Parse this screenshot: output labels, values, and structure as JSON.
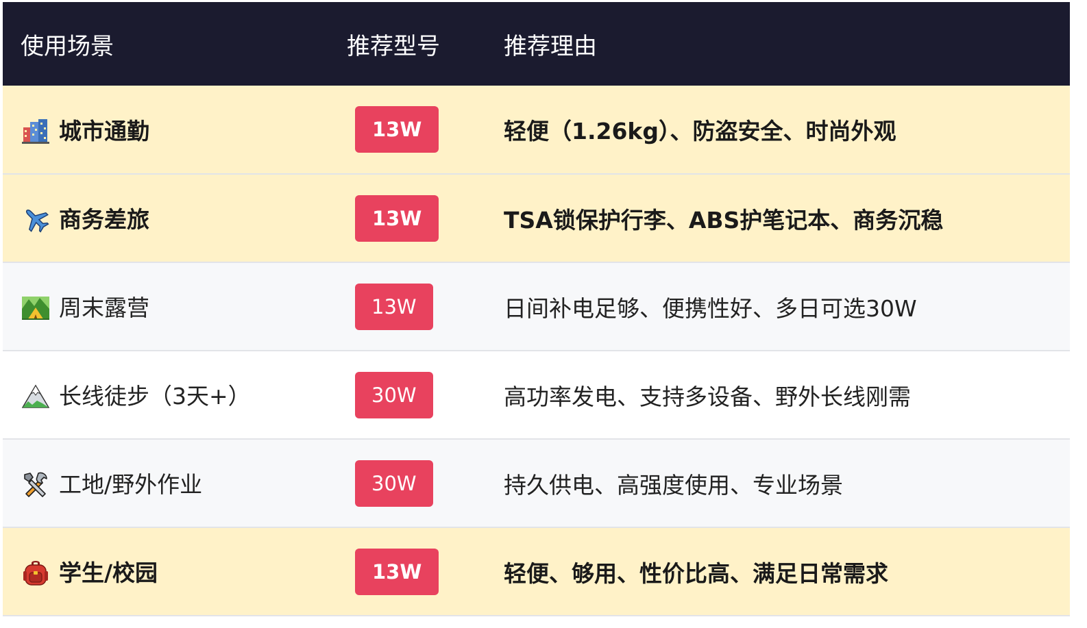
{
  "table": {
    "headers": [
      "使用场景",
      "推荐型号",
      "推荐理由"
    ],
    "rows": [
      {
        "icon": "cityscape-icon",
        "scene": "城市通勤",
        "model": "13W",
        "reason": "轻便（1.26kg）、防盗安全、时尚外观",
        "highlight": true
      },
      {
        "icon": "airplane-icon",
        "scene": "商务差旅",
        "model": "13W",
        "reason": "TSA锁保护行李、ABS护笔记本、商务沉稳",
        "highlight": true
      },
      {
        "icon": "camping-icon",
        "scene": "周末露营",
        "model": "13W",
        "reason": "日间补电足够、便携性好、多日可选30W",
        "highlight": false
      },
      {
        "icon": "mountain-icon",
        "scene": "长线徒步（3天+）",
        "model": "30W",
        "reason": "高功率发电、支持多设备、野外长线刚需",
        "highlight": false
      },
      {
        "icon": "tools-icon",
        "scene": "工地/野外作业",
        "model": "30W",
        "reason": "持久供电、高强度使用、专业场景",
        "highlight": false
      },
      {
        "icon": "backpack-icon",
        "scene": "学生/校园",
        "model": "13W",
        "reason": "轻便、够用、性价比高、满足日常需求",
        "highlight": true
      }
    ]
  },
  "colors": {
    "header_bg": "#1b1b2f",
    "highlight_row": "#fff2c8",
    "badge": "#e8425e"
  }
}
